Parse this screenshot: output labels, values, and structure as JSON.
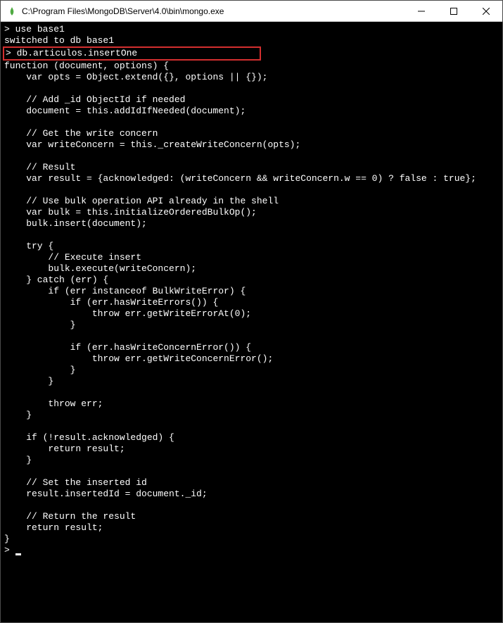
{
  "titlebar": {
    "title": "C:\\Program Files\\MongoDB\\Server\\4.0\\bin\\mongo.exe"
  },
  "terminal": {
    "line1_prompt": "> ",
    "line1_cmd": "use base1",
    "line2": "switched to db base1",
    "line3_prompt": "> ",
    "line3_cmd": "db.articulos.insertOne",
    "code": "function (document, options) {\n    var opts = Object.extend({}, options || {});\n\n    // Add _id ObjectId if needed\n    document = this.addIdIfNeeded(document);\n\n    // Get the write concern\n    var writeConcern = this._createWriteConcern(opts);\n\n    // Result\n    var result = {acknowledged: (writeConcern && writeConcern.w == 0) ? false : true};\n\n    // Use bulk operation API already in the shell\n    var bulk = this.initializeOrderedBulkOp();\n    bulk.insert(document);\n\n    try {\n        // Execute insert\n        bulk.execute(writeConcern);\n    } catch (err) {\n        if (err instanceof BulkWriteError) {\n            if (err.hasWriteErrors()) {\n                throw err.getWriteErrorAt(0);\n            }\n\n            if (err.hasWriteConcernError()) {\n                throw err.getWriteConcernError();\n            }\n        }\n\n        throw err;\n    }\n\n    if (!result.acknowledged) {\n        return result;\n    }\n\n    // Set the inserted id\n    result.insertedId = document._id;\n\n    // Return the result\n    return result;\n}",
    "final_prompt": "> "
  }
}
